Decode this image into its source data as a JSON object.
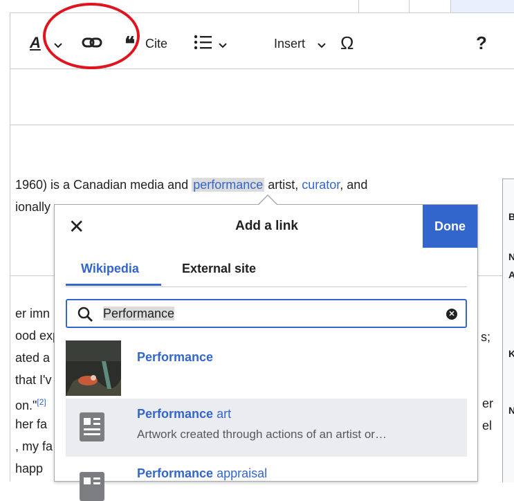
{
  "toolbar": {
    "format_letter": "A",
    "cite_label": "Cite",
    "insert_label": "Insert",
    "special_char": "Ω",
    "help": "?"
  },
  "article": {
    "line1_a": "1960) is a Canadian media and ",
    "line1_link1": "performance",
    "line1_b": " artist, ",
    "line1_link2": "curator",
    "line1_c": ", and",
    "line2": "ionally",
    "left_fragments": [
      "er imn",
      "ood exp",
      "ated a",
      "that I'v",
      "on.\"",
      "her fa",
      ", my fa",
      "happ"
    ],
    "footnote": "[2]",
    "right_fragments": [
      "s;",
      "er",
      "el"
    ]
  },
  "infobox": {
    "letters": [
      "B",
      "N",
      "A",
      "K",
      "N"
    ]
  },
  "link_dialog": {
    "title": "Add a link",
    "close": "✕",
    "done_label": "Done",
    "tabs": [
      "Wikipedia",
      "External site"
    ],
    "active_tab": "Wikipedia",
    "search_value": "Performance",
    "results": [
      {
        "title_bold": "Performance",
        "title_rest": "",
        "description": ""
      },
      {
        "title_bold": "Performance",
        "title_rest": " art",
        "description": "Artwork created through actions of an artist or…"
      },
      {
        "title_bold": "Performance",
        "title_rest": " appraisal",
        "description": ""
      }
    ]
  },
  "colors": {
    "accent": "#3366cc",
    "annotation": "#e0141e",
    "selected_row": "#eaecf0"
  }
}
